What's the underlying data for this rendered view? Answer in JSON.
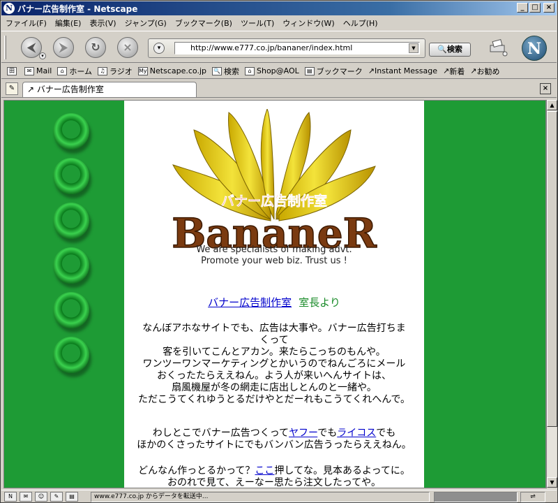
{
  "window": {
    "title": "バナー広告制作室 - Netscape"
  },
  "menu": [
    "ファイル(F)",
    "編集(E)",
    "表示(V)",
    "ジャンプ(G)",
    "ブックマーク(B)",
    "ツール(T)",
    "ウィンドウ(W)",
    "ヘルプ(H)"
  ],
  "nav": {
    "url": "http://www.e777.co.jp/bananer/index.html",
    "search_label": "検索"
  },
  "personal_toolbar": [
    "Mail",
    "ホーム",
    "ラジオ",
    "Netscape.co.jp",
    "検索",
    "Shop@AOL",
    "ブックマーク",
    "Instant Message",
    "新着",
    "お勧め"
  ],
  "tab": {
    "label": "バナー広告制作室"
  },
  "page": {
    "logo_title": "バナー広告制作室",
    "logo_word": "BananeR",
    "tagline_1": "We are specialists of making advt.",
    "tagline_2": "Promote your web biz. Trust us !",
    "headline_link": "バナー広告制作室",
    "headline_suffix": "室長より",
    "p1": [
      "なんぼアホなサイトでも、広告は大事や。バナー広告打ちま",
      "くって",
      "客を引いてこんとアカン。来たらこっちのもんや。",
      "ワンツーワンマーケティングとかいうのでねんごろにメール",
      "おくったたらええねん。よう人が来いへんサイトは、",
      "扇風機屋が冬の網走に店出しとんのと一緒や。",
      "ただこうてくれゆうとるだけやとだーれもこうてくれへんで。"
    ],
    "p2_a": "わしとこでバナー広告つくって",
    "p2_link1": "ヤフー",
    "p2_b": "でも",
    "p2_link2": "ライコス",
    "p2_c": "でも",
    "p2_line2": "ほかのくさったサイトにでもバンバン広告うったらええねん。",
    "p3_a": "どんなん作っとるかって？",
    "p3_link": "ここ",
    "p3_b": "押してな。見本あるよってに。",
    "p3_line2": "おのれで見て、えーなー思たら注文したってや。"
  },
  "status": {
    "text": "www.e777.co.jp からデータを転送中..."
  },
  "colors": {
    "page_green": "#1e9b35",
    "link": "#0000cc",
    "headline_green": "#1b8c2a",
    "title_bar": "#0a246a"
  }
}
